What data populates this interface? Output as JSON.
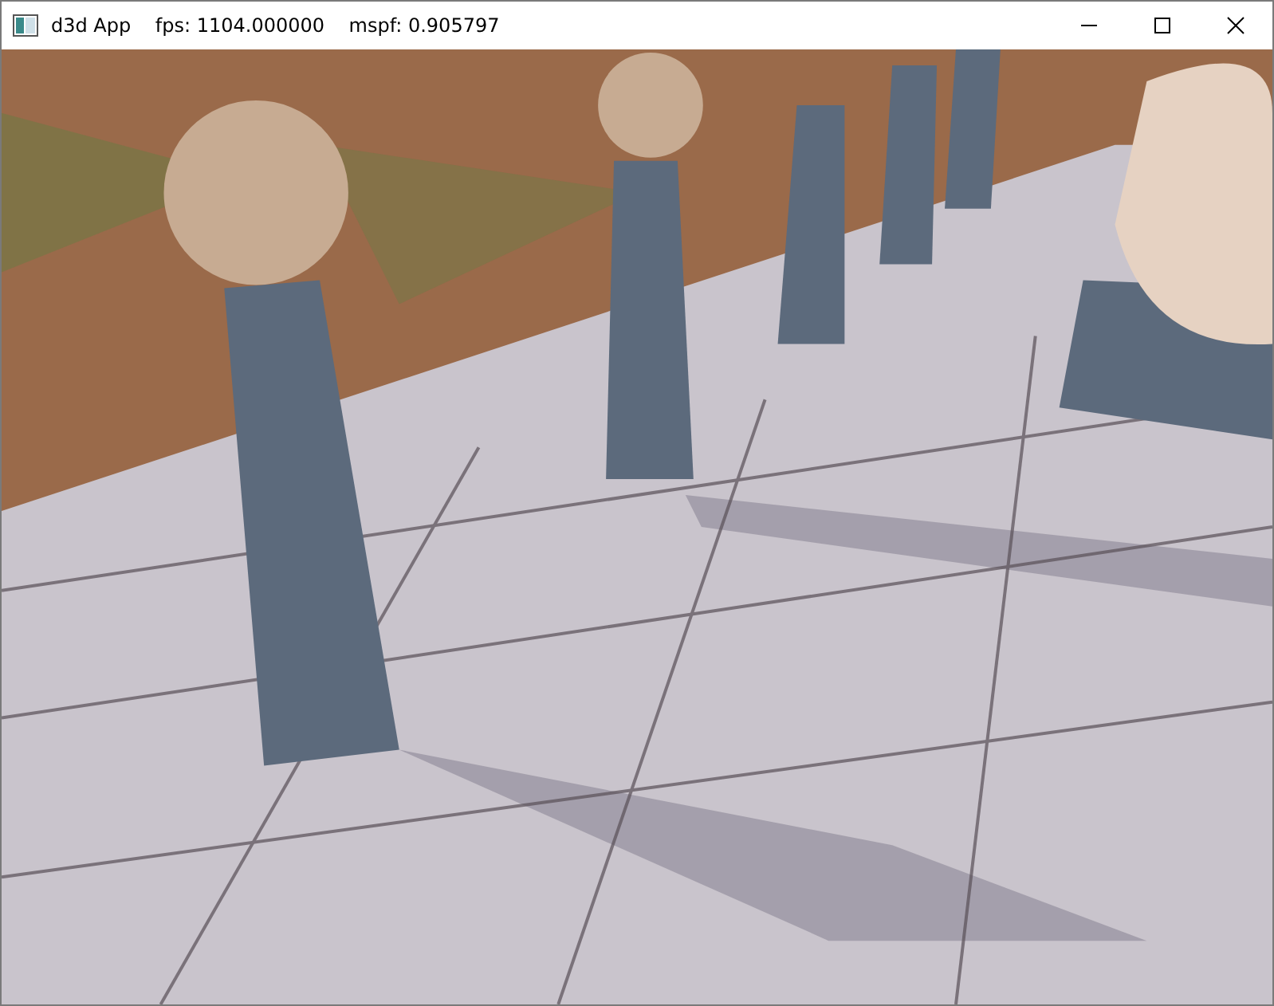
{
  "window": {
    "title": "d3d App    fps: 1104.000000    mspf: 0.905797"
  }
}
